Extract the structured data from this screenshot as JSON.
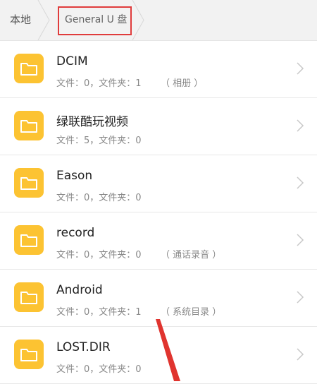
{
  "breadcrumb": {
    "items": [
      {
        "label": "本地"
      },
      {
        "label": "General U 盘"
      }
    ]
  },
  "files": [
    {
      "name": "DCIM",
      "stats": "文件：0，文件夹：1",
      "tag": "（ 相册 ）"
    },
    {
      "name": "绿联酷玩视频",
      "stats": "文件：5，文件夹：0",
      "tag": ""
    },
    {
      "name": "Eason",
      "stats": "文件：0，文件夹：0",
      "tag": ""
    },
    {
      "name": "record",
      "stats": "文件：0，文件夹：0",
      "tag": "（ 通话录音 ）"
    },
    {
      "name": "Android",
      "stats": "文件：0，文件夹：1",
      "tag": "（ 系统目录 ）"
    },
    {
      "name": "LOST.DIR",
      "stats": "文件：0，文件夹：0",
      "tag": ""
    }
  ],
  "colors": {
    "folder": "#fcc332",
    "highlight": "#e03c3c",
    "annotation_arrow": "#e0342f"
  },
  "icons": {
    "folder": "folder-icon",
    "chevron": "chevron-right-icon",
    "separator": "breadcrumb-separator-icon"
  }
}
